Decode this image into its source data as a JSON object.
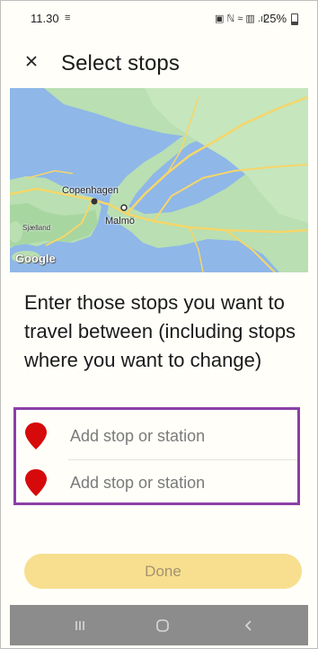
{
  "status_bar": {
    "time": "11.30",
    "msg_icon": "≡",
    "icons": "▣ ℕ ≈ ▥ .ıl",
    "battery": "25%"
  },
  "header": {
    "title": "Select stops",
    "close_icon": "close-icon"
  },
  "map": {
    "labels": {
      "copenhagen": "Copenhagen",
      "malmo": "Malmö",
      "sjaelland": "Sjælland"
    },
    "logo": "Google",
    "colors": {
      "water": "#8fb7e8",
      "land": "#b9dfb2",
      "road": "#f5d66a"
    }
  },
  "prompt": "Enter those stops you want to travel between (including stops where you want to change)",
  "stops": [
    {
      "placeholder": "Add stop or station",
      "value": "",
      "icon": "map-pin-icon"
    },
    {
      "placeholder": "Add stop or station",
      "value": "",
      "icon": "map-pin-icon"
    }
  ],
  "done_button": {
    "label": "Done",
    "color": "#f7df8f"
  },
  "nav_bar": {
    "recents_icon": "recents-icon",
    "home_icon": "home-icon",
    "back_icon": "back-icon"
  },
  "colors": {
    "highlight": "#8a3fa5",
    "pin": "#d60a0a"
  }
}
